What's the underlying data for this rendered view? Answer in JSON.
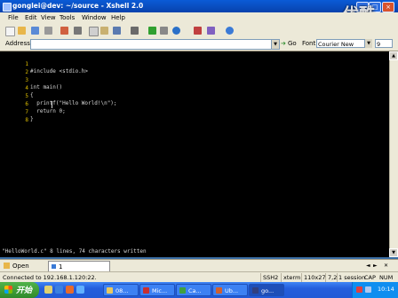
{
  "window": {
    "title": "gonglei@dev: ~/source - Xshell 2.0",
    "controls": [
      "_",
      "□",
      "×"
    ]
  },
  "watermark": {
    "text": "优酷"
  },
  "menu": {
    "items": [
      "File",
      "Edit",
      "View",
      "Tools",
      "Window",
      "Help"
    ]
  },
  "address_bar": {
    "label": "Address",
    "value": "",
    "go_label": "Go",
    "font_label": "Font",
    "font_value": "Courier New",
    "font_size": "9"
  },
  "terminal": {
    "lines": [
      {
        "n": "1",
        "code": "#include <stdio.h>"
      },
      {
        "n": "2",
        "code": ""
      },
      {
        "n": "3",
        "code": "int main()"
      },
      {
        "n": "4",
        "code": "{"
      },
      {
        "n": "5",
        "code": "  printf(\"Hello World!\\n\");"
      },
      {
        "n": "6",
        "code": "  return 0;"
      },
      {
        "n": "7",
        "code": "}"
      },
      {
        "n": "8",
        "code": ""
      }
    ],
    "status_message": "\"HelloWorld.c\" 8 lines, 74 characters written"
  },
  "tabbar": {
    "open_label": "Open",
    "session_label": "1 192.168.1.120"
  },
  "statusbar": {
    "connection": "Connected to 192.168.1.120:22.",
    "protocol": "SSH2",
    "term": "xterm",
    "size": "110x27",
    "cursor": "7,2",
    "sessions": "1 session",
    "caps": "CAP",
    "num": "NUM"
  },
  "taskbar": {
    "start_label": "开始",
    "tasks": [
      {
        "label": "08...",
        "icon_color": "#e8c860"
      },
      {
        "label": "Mic...",
        "icon_color": "#c83030"
      },
      {
        "label": "Ca...",
        "icon_color": "#40a040"
      },
      {
        "label": "Ub...",
        "icon_color": "#d06030"
      },
      {
        "label": "go...",
        "icon_color": "#304080"
      }
    ],
    "time": "10:14"
  },
  "colors": {
    "titlebar": "#0a5bd6",
    "terminal_bg": "#000000",
    "line_number": "#e0c000",
    "taskbar": "#245edc",
    "start_button": "#2f8a2a"
  }
}
